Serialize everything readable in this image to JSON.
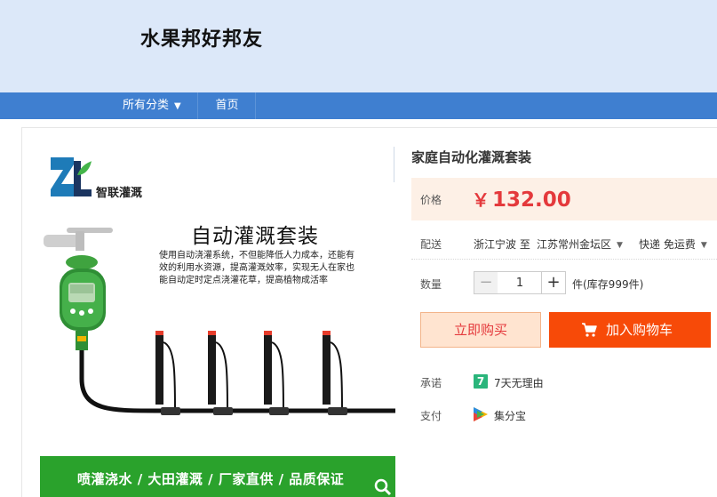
{
  "header": {
    "shop_title": "水果邦好邦友"
  },
  "nav": {
    "categories_label": "所有分类",
    "home_label": "首页"
  },
  "product_image": {
    "brand_name": "智联灌溉",
    "heading": "自动灌溉套装",
    "description_lines": [
      "使用自动浇灌系统，不但能降低人力成本，还能有",
      "效的利用水资源，提高灌溉效率，实现无人在家也",
      "能自动定时定点浇灌花草，提高植物成活率"
    ],
    "banner_text": "喷灌浇水 / 大田灌溉 / 厂家直供 / 品质保证"
  },
  "product": {
    "name": "家庭自动化灌溉套装",
    "price_label": "价格",
    "currency": "￥",
    "price": "132.00",
    "shipping_label": "配送",
    "ship_from": "浙江宁波 至",
    "ship_to": "江苏常州金坛区",
    "ship_method": "快递 免运费",
    "quantity_label": "数量",
    "quantity": "1",
    "minus": "−",
    "plus": "+",
    "stock_text": "件(库存999件)",
    "buy_now_label": "立即购买",
    "add_to_cart_label": "加入购物车",
    "promise_label": "承诺",
    "promise_icon_text": "7",
    "promise_text": "7天无理由",
    "payment_label": "支付",
    "payment_text": "集分宝"
  },
  "colors": {
    "header_bg": "#dce8f9",
    "nav_bg": "#3f7fd0",
    "price_red": "#e4393c",
    "cart_orange": "#f74a08",
    "banner_green": "#2aa22c"
  },
  "icons": [
    "dropdown-triangle-icon",
    "cart-icon",
    "seven-day-icon",
    "payment-icon",
    "zoom-icon",
    "brand-logo-icon"
  ]
}
